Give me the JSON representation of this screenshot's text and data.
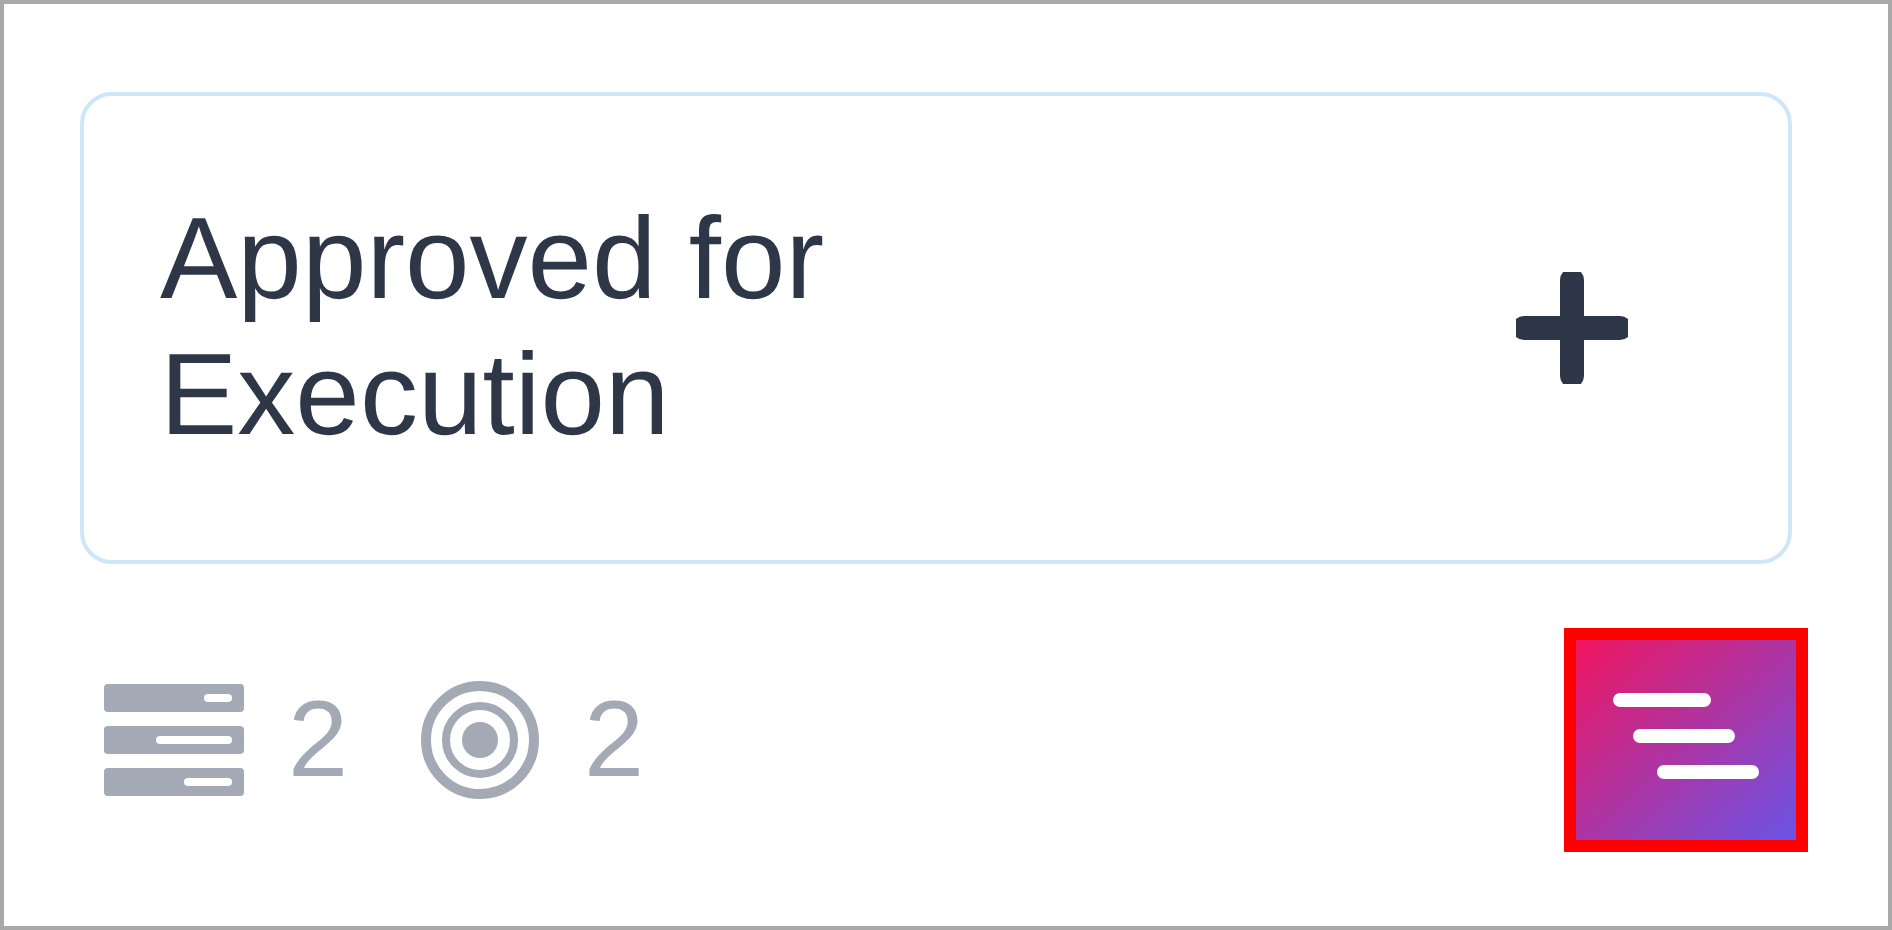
{
  "card": {
    "title": "Approved for Execution"
  },
  "stats": [
    {
      "kind": "rows",
      "count": "2"
    },
    {
      "kind": "target",
      "count": "2"
    }
  ],
  "menu_button": {
    "highlighted": true
  }
}
